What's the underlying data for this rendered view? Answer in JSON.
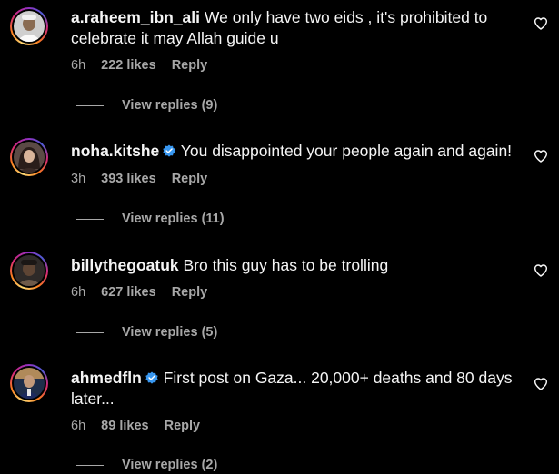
{
  "comments": [
    {
      "username": "a.raheem_ibn_ali",
      "text": "We only have two eids , it's prohibited to celebrate it may Allah guide u",
      "time": "6h",
      "likes": "222 likes",
      "reply": "Reply",
      "view_replies": "View replies (9)",
      "verified": false,
      "avatar_icon": "avatar-photo"
    },
    {
      "username": "noha.kitshe",
      "text": "You disappointed your people again and again!",
      "time": "3h",
      "likes": "393 likes",
      "reply": "Reply",
      "view_replies": "View replies (11)",
      "verified": true,
      "avatar_icon": "avatar-photo"
    },
    {
      "username": "billythegoatuk",
      "text": "Bro this guy has to be trolling",
      "time": "6h",
      "likes": "627 likes",
      "reply": "Reply",
      "view_replies": "View replies (5)",
      "verified": false,
      "avatar_icon": "avatar-photo"
    },
    {
      "username": "ahmedfln",
      "text": "First post on Gaza... 20,000+ deaths and 80 days later...",
      "time": "6h",
      "likes": "89 likes",
      "reply": "Reply",
      "view_replies": "View replies (2)",
      "verified": true,
      "avatar_icon": "avatar-photo"
    }
  ],
  "colors": {
    "background": "#000000",
    "text": "#f5f5f5",
    "secondary_text": "#a8a8a8",
    "verified_badge": "#3897f0"
  },
  "icons": {
    "like": "heart-outline-icon",
    "verified": "verified-badge-icon"
  }
}
